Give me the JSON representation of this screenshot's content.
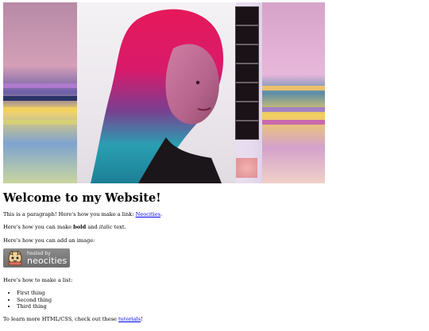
{
  "hero": {
    "image_description": ""
  },
  "content": {
    "heading": "Welcome to my Website!",
    "p1_text": "This is a paragraph! Here's how you make a link: ",
    "p1_link": "Neocities",
    "p1_end": ".",
    "p2_prefix": "Here's how you can make ",
    "p2_bold": "bold",
    "p2_mid": " and ",
    "p2_italic": "italic",
    "p2_suffix": " text.",
    "p3_text": "Here's how you can add an image:",
    "badge": {
      "small": "hosted by",
      "big": "neocities"
    },
    "p4_text": "Here's how to make a list:",
    "list_items": [
      "First thing",
      "Second thing",
      "Third thing"
    ],
    "p5_text": "To learn more HTML/CSS, check out these ",
    "p5_link": "tutorials",
    "p5_end": "!"
  }
}
